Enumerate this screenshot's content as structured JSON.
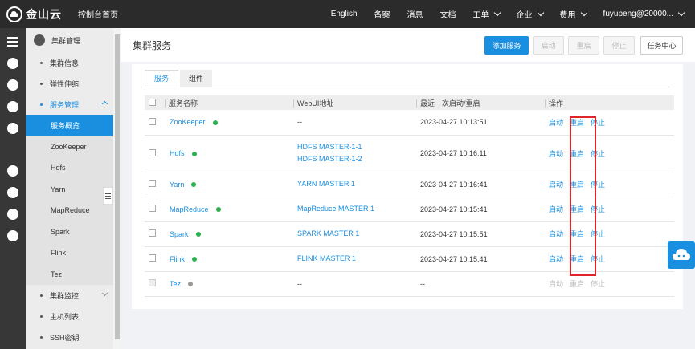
{
  "topbar": {
    "logo_text": "金山云",
    "console_home": "控制台首页",
    "nav": [
      {
        "label": "English",
        "dropdown": false
      },
      {
        "label": "备案",
        "dropdown": false
      },
      {
        "label": "消息",
        "dropdown": false
      },
      {
        "label": "文档",
        "dropdown": false
      },
      {
        "label": "工单",
        "dropdown": true
      },
      {
        "label": "企业",
        "dropdown": true
      },
      {
        "label": "费用",
        "dropdown": true
      },
      {
        "label": "fuyupeng@20000...",
        "dropdown": true
      }
    ]
  },
  "sidebar": {
    "header": "集群管理",
    "items": [
      {
        "label": "集群信息"
      },
      {
        "label": "弹性伸缩"
      },
      {
        "label": "服务管理"
      }
    ],
    "subitems": [
      "服务概览",
      "ZooKeeper",
      "Hdfs",
      "Yarn",
      "MapReduce",
      "Spark",
      "Flink",
      "Tez"
    ],
    "bottom_items": [
      {
        "label": "集群监控"
      },
      {
        "label": "主机列表"
      },
      {
        "label": "SSH密钥"
      }
    ]
  },
  "page": {
    "title": "集群服务",
    "buttons": {
      "add": "添加服务",
      "start": "启动",
      "restart": "重启",
      "stop": "停止",
      "tasks": "任务中心"
    },
    "tabs": [
      "服务",
      "组件"
    ]
  },
  "table": {
    "headers": [
      "服务名称",
      "WebUI地址",
      "最近一次启动/重启",
      "操作"
    ],
    "rows": [
      {
        "name": "ZooKeeper",
        "status": "running",
        "webui": [
          "--"
        ],
        "time": "2023-04-27 10:13:51",
        "ops": [
          "启动",
          "重启",
          "停止"
        ],
        "enabled": true
      },
      {
        "name": "Hdfs",
        "status": "running",
        "webui": [
          "HDFS MASTER-1-1",
          "HDFS MASTER-1-2"
        ],
        "time": "2023-04-27 10:16:11",
        "ops": [
          "启动",
          "重启",
          "停止"
        ],
        "enabled": true
      },
      {
        "name": "Yarn",
        "status": "running",
        "webui": [
          "YARN MASTER 1"
        ],
        "time": "2023-04-27 10:16:41",
        "ops": [
          "启动",
          "重启",
          "停止"
        ],
        "enabled": true
      },
      {
        "name": "MapReduce",
        "status": "running",
        "webui": [
          "MapReduce MASTER 1"
        ],
        "time": "2023-04-27 10:15:41",
        "ops": [
          "启动",
          "重启",
          "停止"
        ],
        "enabled": true
      },
      {
        "name": "Spark",
        "status": "running",
        "webui": [
          "SPARK MASTER 1"
        ],
        "time": "2023-04-27 10:15:51",
        "ops": [
          "启动",
          "重启",
          "停止"
        ],
        "enabled": true
      },
      {
        "name": "Flink",
        "status": "running",
        "webui": [
          "FLINK MASTER 1"
        ],
        "time": "2023-04-27 10:15:41",
        "ops": [
          "启动",
          "重启",
          "停止"
        ],
        "enabled": true
      },
      {
        "name": "Tez",
        "status": "unknown",
        "webui": [
          "--"
        ],
        "time": "--",
        "ops": [
          "启动",
          "重启",
          "停止"
        ],
        "enabled": false
      }
    ]
  },
  "colors": {
    "accent": "#1a8fe0",
    "status_ok": "#2ab24e",
    "status_grey": "#999999",
    "highlight": "#e0242a"
  }
}
